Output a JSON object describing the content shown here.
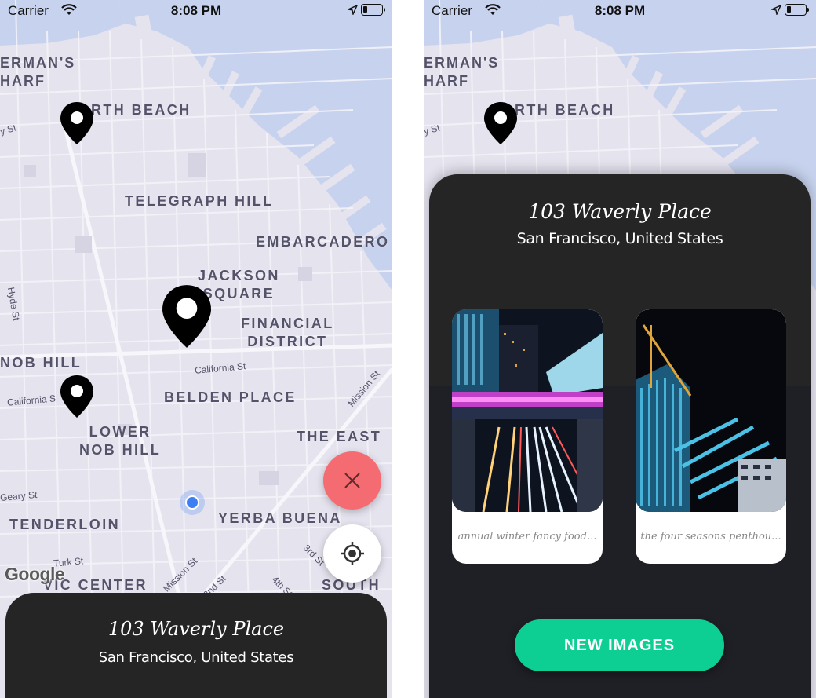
{
  "status_bar": {
    "carrier": "Carrier",
    "time": "8:08 PM",
    "battery_level": 0.25
  },
  "map": {
    "districts": {
      "fishermans_wharf": "ERMAN'S\nHARF",
      "north_beach": "RTH BEACH",
      "telegraph_hill": "TELEGRAPH HILL",
      "embarcadero": "EMBARCADERO",
      "jackson_square": "JACKSON\nSQUARE",
      "financial_district": "FINANCIAL\nDISTRICT",
      "nob_hill": "NOB HILL",
      "belden_place": "BELDEN PLACE",
      "lower_nob_hill": "LOWER\nNOB HILL",
      "the_east": "THE EAST",
      "tenderloin": "TENDERLOIN",
      "yerba_buena": "YERBA BUENA",
      "civic_center": "VIC CENTER",
      "south": "SOUTH"
    },
    "streets": {
      "y_st": "y St",
      "hyde_st": "Hyde St",
      "california_st_1": "California St",
      "california_st_2": "California S",
      "mission_st_1": "Mission St",
      "geary_st": "Geary St",
      "turk_st": "Turk St",
      "mission_st_2": "Mission St",
      "third_st": "3rd St",
      "second_st": "2nd St",
      "fourth_st": "4th St"
    },
    "attribution": "Google",
    "colors": {
      "land": "#e5e3ee",
      "water": "#c7d3ee",
      "streets": "#f4f3f8",
      "labels": "#55536a"
    }
  },
  "location_sheet": {
    "title": "103 Waverly Place",
    "subtitle": "San Francisco, United States"
  },
  "image_cards": [
    {
      "caption": "annual winter fancy food..."
    },
    {
      "caption": "the four seasons penthou..."
    }
  ],
  "new_images_button": {
    "label": "NEW IMAGES",
    "color": "#0ecf93"
  },
  "fab": {
    "close_color": "#f46c72",
    "locate_color": "#ffffff"
  },
  "sheet_color": "#252525"
}
